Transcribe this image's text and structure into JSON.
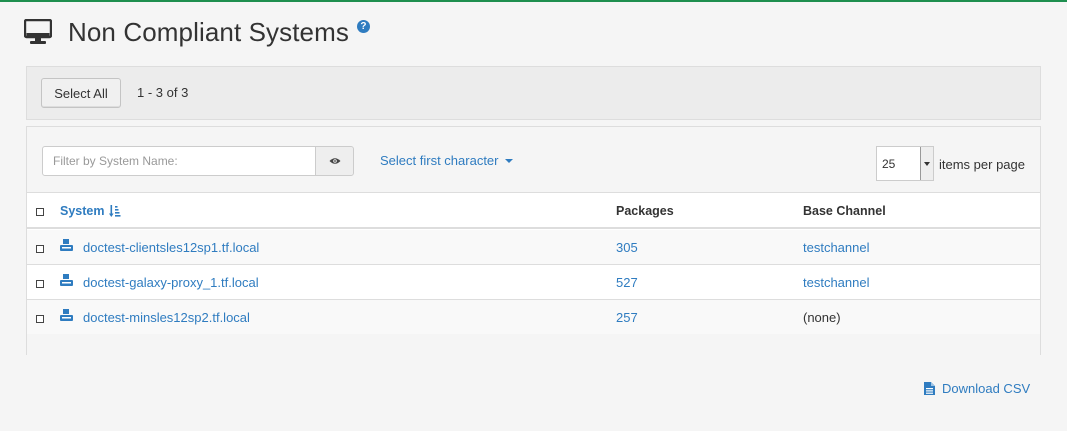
{
  "header": {
    "title": "Non Compliant Systems",
    "help_glyph": "?",
    "icon": "monitor-icon",
    "accent_color": "#1e8f4f",
    "link_color": "#2f7cc0"
  },
  "toolbar": {
    "select_all_label": "Select All",
    "range_text": "1 - 3 of 3"
  },
  "filter": {
    "placeholder": "Filter by System Name:",
    "value": "",
    "first_character_label": "Select first character",
    "per_page_value": "25",
    "per_page_label": "items per page"
  },
  "table": {
    "columns": [
      "System",
      "Packages",
      "Base Channel"
    ],
    "rows": [
      {
        "system": "doctest-clientsles12sp1.tf.local",
        "packages": "305",
        "base_channel": "testchannel"
      },
      {
        "system": "doctest-galaxy-proxy_1.tf.local",
        "packages": "527",
        "base_channel": "testchannel"
      },
      {
        "system": "doctest-minsles12sp2.tf.local",
        "packages": "257",
        "base_channel": "(none)"
      }
    ]
  },
  "footer": {
    "download_label": "Download CSV"
  }
}
